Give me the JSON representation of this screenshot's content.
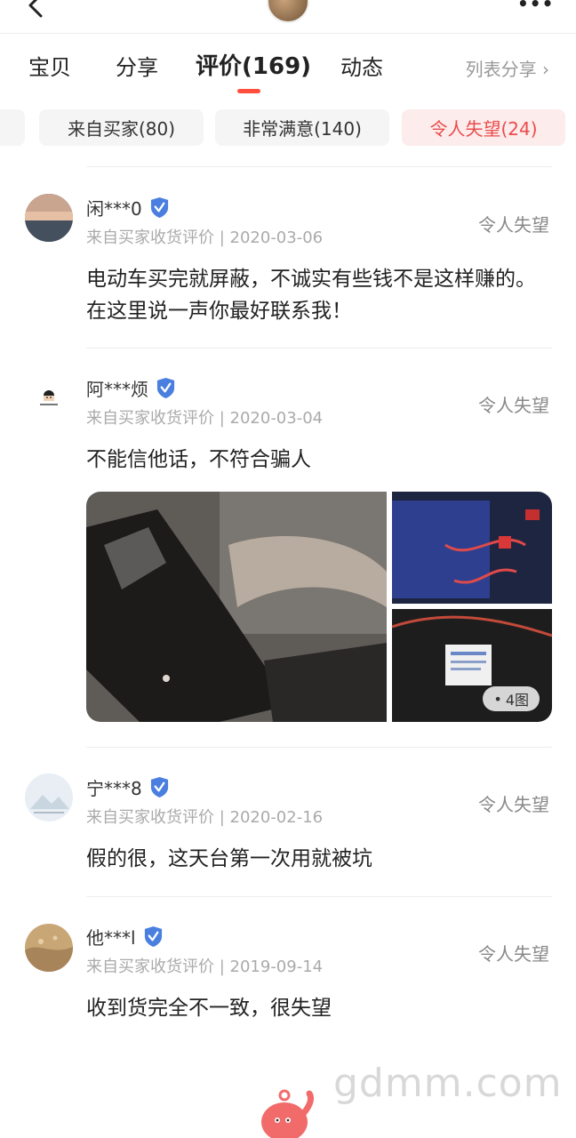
{
  "header": {
    "back_icon": "chevron-left-icon",
    "more_icon": "more-dots-icon"
  },
  "tabs": [
    {
      "label": "宝贝"
    },
    {
      "label": "分享"
    },
    {
      "label": "评价(169)",
      "active": true
    },
    {
      "label": "动态"
    }
  ],
  "list_share": "列表分享 ›",
  "chips": [
    {
      "label": "来自买家(80)"
    },
    {
      "label": "非常满意(140)"
    },
    {
      "label": "令人失望(24)",
      "active": true
    }
  ],
  "reviews": [
    {
      "user": "闲***0",
      "meta": "来自买家收货评价 | 2020-03-06",
      "status": "令人失望",
      "content": "电动车买完就屏蔽，不诚实有些钱不是这样赚的。在这里说一声你最好联系我！"
    },
    {
      "user": "阿***烦",
      "meta": "来自买家收货评价 | 2020-03-04",
      "status": "令人失望",
      "content": "不能信他话，不符合骗人",
      "image_count": "4图"
    },
    {
      "user": "宁***8",
      "meta": "来自买家收货评价 | 2020-02-16",
      "status": "令人失望",
      "content": "假的很，这天台第一次用就被坑"
    },
    {
      "user": "他***l",
      "meta": "来自买家收货评价 | 2019-09-14",
      "status": "令人失望",
      "content": "收到货完全不一致，很失望"
    }
  ],
  "watermark": "gdmm.com",
  "colors": {
    "accent": "#ff4f3c",
    "chip_active_bg": "#fdecec",
    "chip_active_text": "#ea4b4b",
    "verified_badge": "#4a7fe0"
  }
}
